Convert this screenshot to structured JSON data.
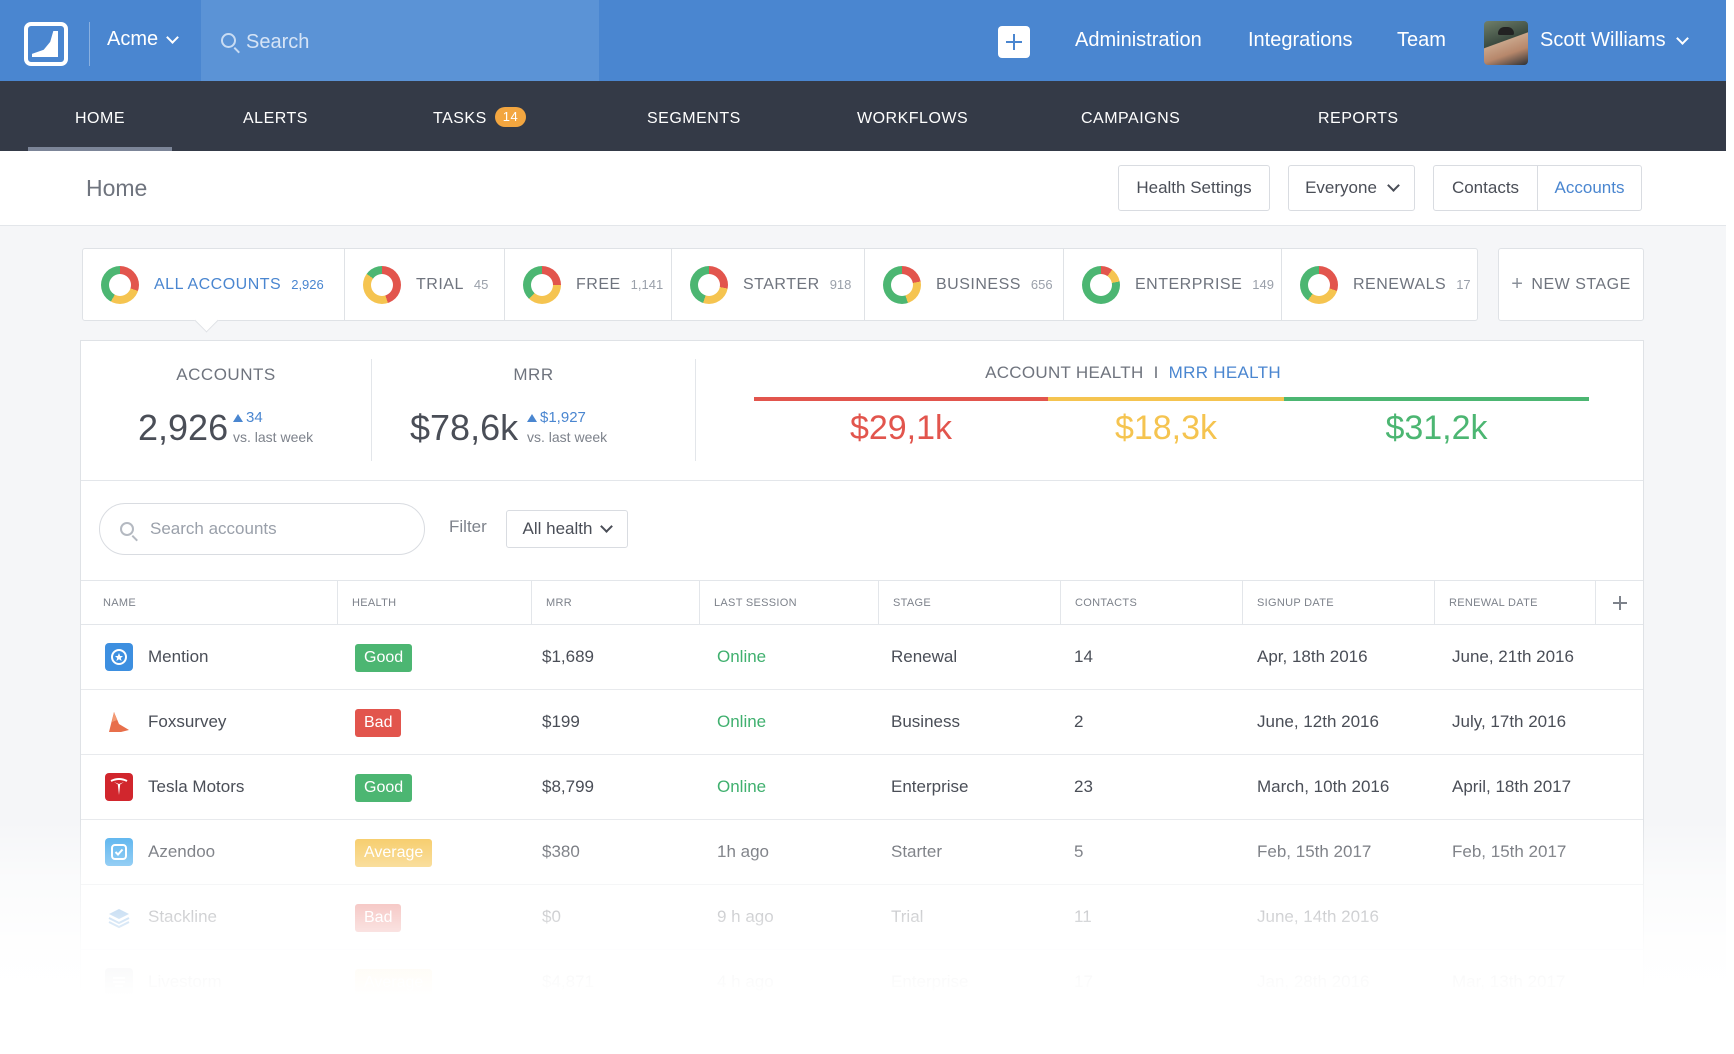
{
  "topbar": {
    "org_name": "Acme",
    "search_placeholder": "Search",
    "nav": [
      "Administration",
      "Integrations",
      "Team"
    ],
    "user_name": "Scott Williams",
    "accent": "#4a86d0"
  },
  "mainnav": {
    "tabs": [
      {
        "label": "HOME",
        "active": true
      },
      {
        "label": "ALERTS"
      },
      {
        "label": "TASKS",
        "badge": "14"
      },
      {
        "label": "SEGMENTS"
      },
      {
        "label": "WORKFLOWS"
      },
      {
        "label": "CAMPAIGNS"
      },
      {
        "label": "REPORTS"
      }
    ]
  },
  "header": {
    "title": "Home",
    "health_settings": "Health Settings",
    "audience": "Everyone",
    "toggle": [
      "Contacts",
      "Accounts"
    ]
  },
  "stages": [
    {
      "label": "ALL ACCOUNTS",
      "count": "2,926"
    },
    {
      "label": "TRIAL",
      "count": "45"
    },
    {
      "label": "FREE",
      "count": "1,141"
    },
    {
      "label": "STARTER",
      "count": "918"
    },
    {
      "label": "BUSINESS",
      "count": "656"
    },
    {
      "label": "ENTERPRISE",
      "count": "149"
    },
    {
      "label": "RENEWALS",
      "count": "17"
    }
  ],
  "new_stage": "NEW STAGE",
  "stats": {
    "accounts": {
      "title": "ACCOUNTS",
      "value": "2,926",
      "delta": "34",
      "vs": "vs. last week"
    },
    "mrr": {
      "title": "MRR",
      "value": "$78,6k",
      "delta": "$1,927",
      "vs": "vs. last week"
    },
    "health": {
      "title_a": "ACCOUNT HEALTH",
      "sep": "I",
      "title_b": "MRR HEALTH",
      "bad": "$29,1k",
      "average": "$18,3k",
      "good": "$31,2k"
    }
  },
  "colors": {
    "bad": "#e2554d",
    "average": "#f5c450",
    "good": "#4cb672"
  },
  "filters": {
    "search_placeholder": "Search accounts",
    "label": "Filter",
    "value": "All health"
  },
  "table": {
    "columns": [
      "NAME",
      "HEALTH",
      "MRR",
      "LAST SESSION",
      "STAGE",
      "CONTACTS",
      "SIGNUP DATE",
      "RENEWAL DATE"
    ],
    "rows": [
      {
        "name": "Mention",
        "health": "Good",
        "mrr": "$1,689",
        "session": "Online",
        "stage": "Renewal",
        "contacts": "14",
        "signup": "Apr, 18th 2016",
        "renewal": "June, 21th 2016"
      },
      {
        "name": "Foxsurvey",
        "health": "Bad",
        "mrr": "$199",
        "session": "Online",
        "stage": "Business",
        "contacts": "2",
        "signup": "June, 12th 2016",
        "renewal": "July, 17th 2016"
      },
      {
        "name": "Tesla Motors",
        "health": "Good",
        "mrr": "$8,799",
        "session": "Online",
        "stage": "Enterprise",
        "contacts": "23",
        "signup": "March, 10th 2016",
        "renewal": "April, 18th 2017"
      },
      {
        "name": "Azendoo",
        "health": "Average",
        "mrr": "$380",
        "session": "1h ago",
        "stage": "Starter",
        "contacts": "5",
        "signup": "Feb, 15th 2017",
        "renewal": "Feb, 15th 2017"
      },
      {
        "name": "Stackline",
        "health": "Bad",
        "mrr": "$0",
        "session": "9 h ago",
        "stage": "Trial",
        "contacts": "11",
        "signup": "June, 14th 2016",
        "renewal": ""
      },
      {
        "name": "Livestorm",
        "health": "Average",
        "mrr": "$4,871",
        "session": "4 h ago",
        "stage": "Enterprise",
        "contacts": "17",
        "signup": "Jan, 28th 2016",
        "renewal": "Mar, 13th 2017"
      }
    ]
  }
}
